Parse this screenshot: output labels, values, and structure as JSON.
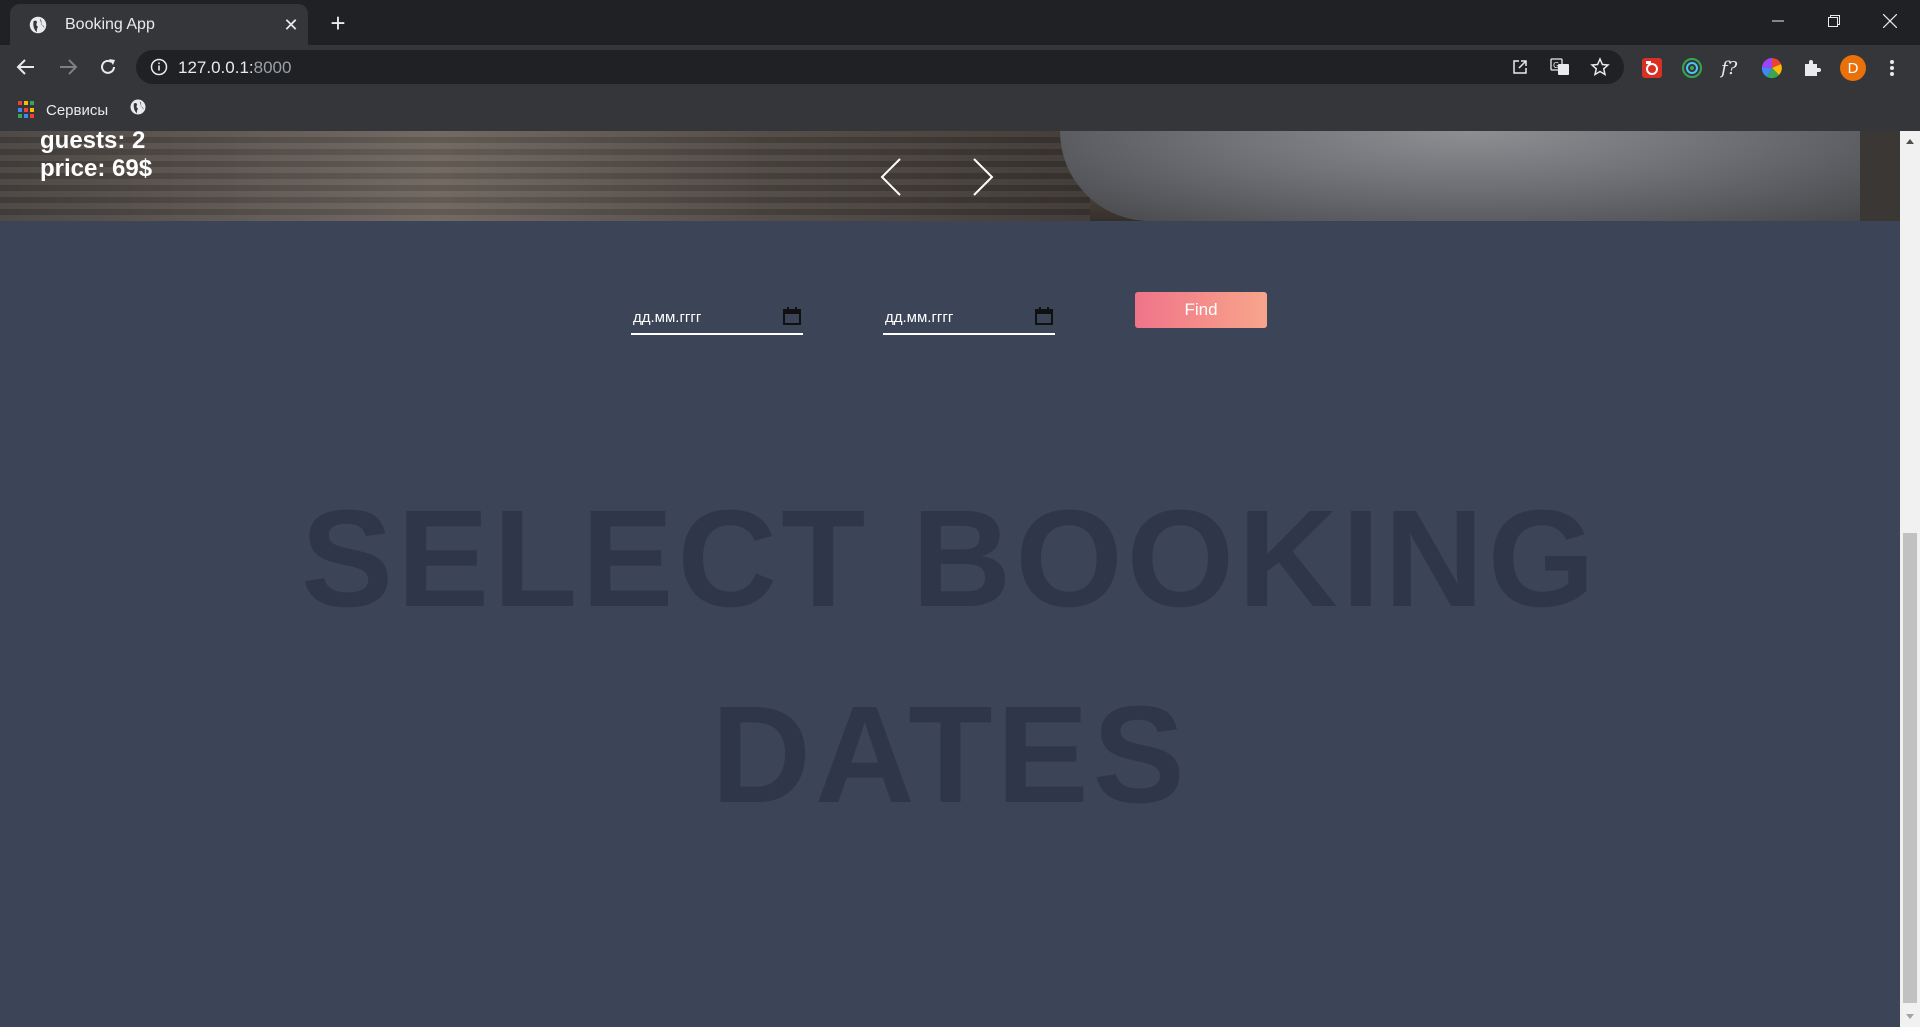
{
  "browser": {
    "tab_title": "Booking App",
    "url_host": "127.0.0.1:",
    "url_port": "8000",
    "profile_initial": "D",
    "bookmarks": {
      "apps_label": "Сервисы"
    },
    "extensions": [
      "screenshot-ext-icon",
      "target-ext-icon",
      "formula-ext-icon",
      "color-wheel-ext-icon",
      "puzzle-icon"
    ]
  },
  "hero": {
    "guests": "guests: 2",
    "price": "price: 69$"
  },
  "search": {
    "checkin_placeholder": "дд.мм.гггг",
    "checkout_placeholder": "дд.мм.гггг",
    "find_label": "Find"
  },
  "message": {
    "line1": "SELECT BOOKING",
    "line2": "DATES"
  },
  "colors": {
    "page_bg": "#3c4457",
    "message_text": "#2f364a",
    "button_gradient_start": "#ef7489",
    "button_gradient_end": "#f8a58b"
  }
}
